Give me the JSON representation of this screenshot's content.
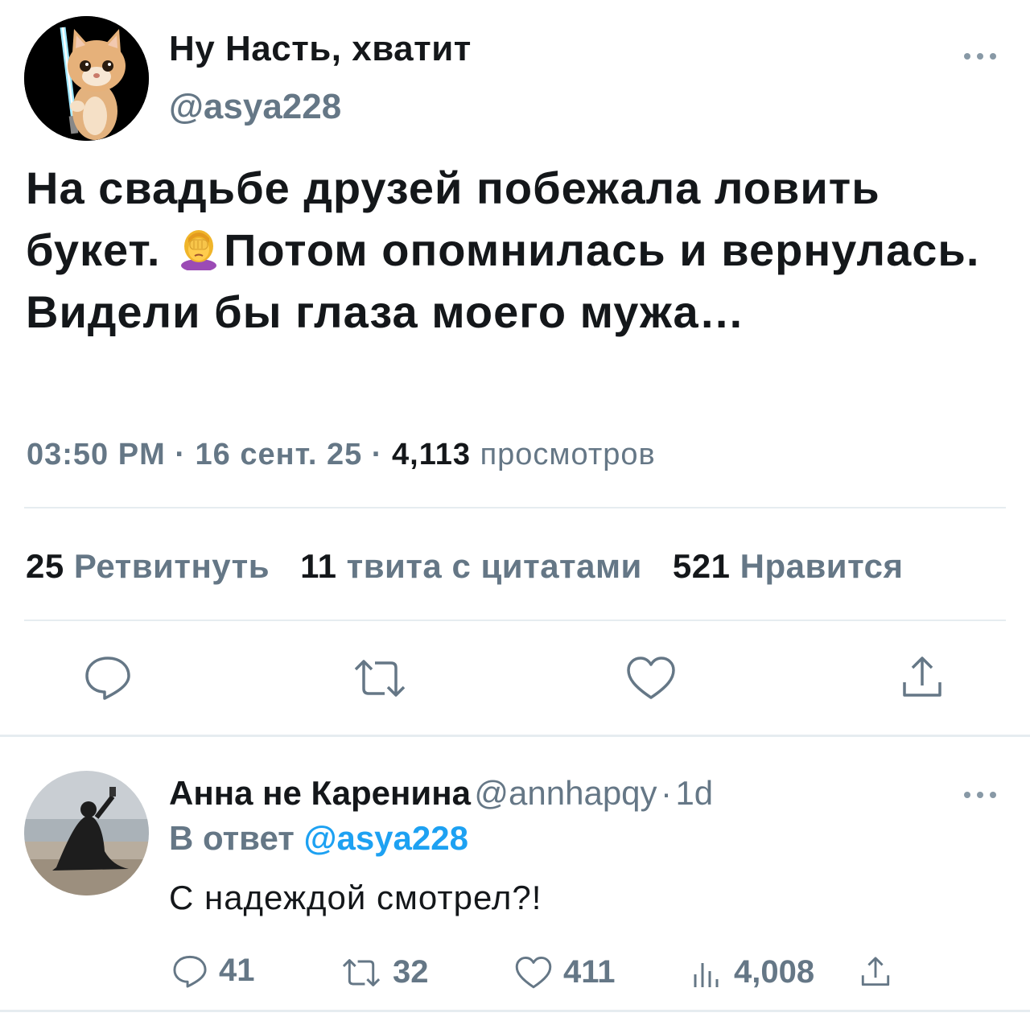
{
  "main_tweet": {
    "display_name": "Ну Насть, хватит",
    "handle": "@asya228",
    "text_part1": "На свадьбе друзей побежала ловить букет. ",
    "text_emoji": "woman-facepalming-icon",
    "text_part2": "Потом опомнилась и вернулась. Видели бы глаза моего мужа…",
    "time": "03:50 PM",
    "separator": "·",
    "date": "16 сент. 25",
    "views_count": "4,113",
    "views_label": "просмотров",
    "stats": {
      "retweets_count": "25",
      "retweets_label": "Ретвитнуть",
      "quotes_count": "11",
      "quotes_label": "твита с цитатами",
      "likes_count": "521",
      "likes_label": "Нравится"
    }
  },
  "reply": {
    "display_name": "Анна не Каренина",
    "handle": "@annhapqy",
    "separator": "·",
    "time_ago": "1d",
    "reply_to_label": "В ответ",
    "reply_to_handle": "@asya228",
    "text": "С надеждой смотрел?!",
    "counts": {
      "replies": "41",
      "retweets": "32",
      "likes": "411",
      "views": "4,008"
    }
  },
  "colors": {
    "text": "#14171a",
    "secondary": "#657786",
    "link": "#1da1f2",
    "divider": "#e6ecf0"
  }
}
